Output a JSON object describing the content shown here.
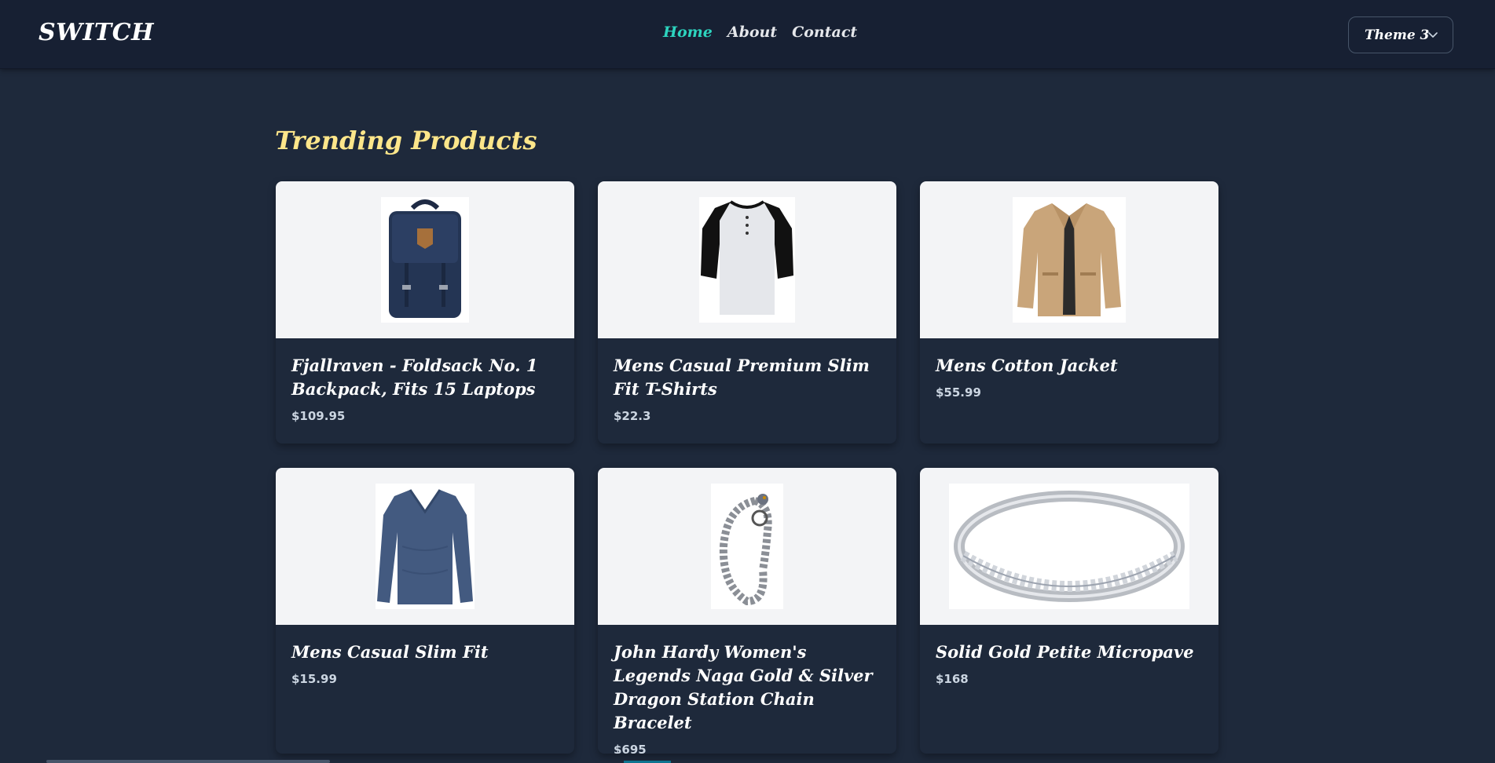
{
  "brand": "SWITCH",
  "nav": {
    "links": [
      {
        "label": "Home",
        "active": true
      },
      {
        "label": "About",
        "active": false
      },
      {
        "label": "Contact",
        "active": false
      }
    ]
  },
  "theme_select": {
    "value": "Theme 3"
  },
  "section_title": "Trending Products",
  "products": [
    {
      "title": "Fjallraven - Foldsack No. 1 Backpack, Fits 15 Laptops",
      "price": "$109.95",
      "icon": "backpack"
    },
    {
      "title": "Mens Casual Premium Slim Fit T-Shirts",
      "price": "$22.3",
      "icon": "t-shirt"
    },
    {
      "title": "Mens Cotton Jacket",
      "price": "$55.99",
      "icon": "jacket"
    },
    {
      "title": "Mens Casual Slim Fit",
      "price": "$15.99",
      "icon": "long-sleeve-shirt"
    },
    {
      "title": "John Hardy Women's Legends Naga Gold & Silver Dragon Station Chain Bracelet",
      "price": "$695",
      "icon": "chain-bracelet"
    },
    {
      "title": "Solid Gold Petite Micropave",
      "price": "$168",
      "icon": "ring"
    }
  ],
  "colors": {
    "background": "#1e293b",
    "navbar": "#172033",
    "active_link": "#2dd4bf",
    "section_title": "#fde68a",
    "image_bg": "#f3f4f6"
  }
}
